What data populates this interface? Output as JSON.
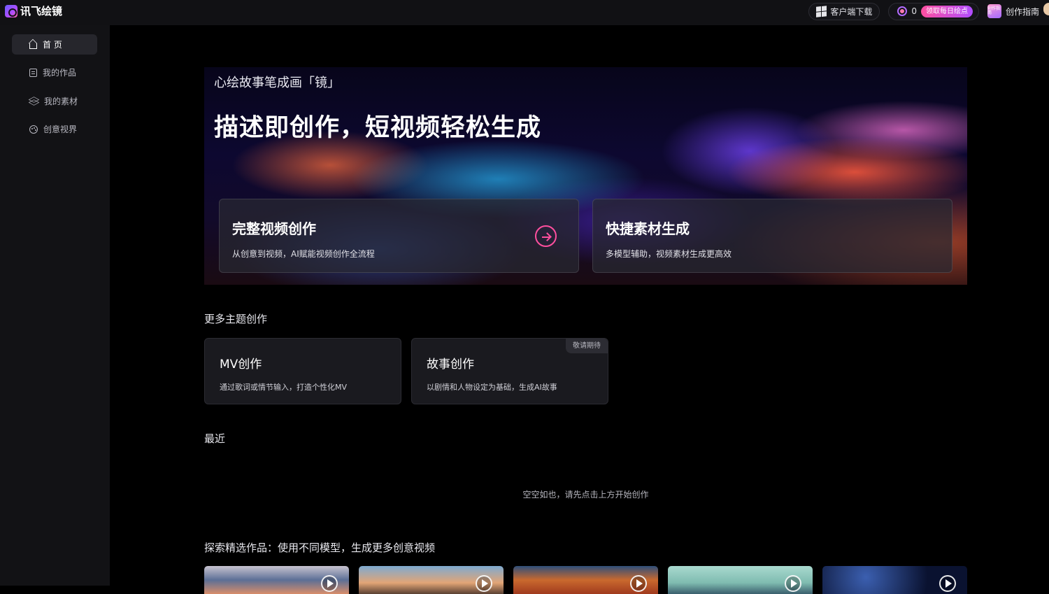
{
  "app": {
    "name": "讯飞绘镜"
  },
  "topbar": {
    "download_label": "客户端下载",
    "credits": "0",
    "daily_points_label": "领取每日绘点",
    "guide_label": "创作指南",
    "guide_icon_text": "创作指南"
  },
  "sidebar": {
    "items": [
      {
        "label": "首 页",
        "icon": "home-icon",
        "active": true
      },
      {
        "label": "我的作品",
        "icon": "document-icon",
        "active": false
      },
      {
        "label": "我的素材",
        "icon": "layers-icon",
        "active": false
      },
      {
        "label": "创意视界",
        "icon": "palette-icon",
        "active": false
      }
    ]
  },
  "hero": {
    "subtitle": "心绘故事笔成画「镜」",
    "title": "描述即创作，短视频轻松生成",
    "cards": [
      {
        "title": "完整视频创作",
        "desc": "从创意到视频，AI赋能视频创作全流程",
        "icon": "arrow-right-circle-icon"
      },
      {
        "title": "快捷素材生成",
        "desc": "多模型辅助，视频素材生成更高效"
      }
    ]
  },
  "themes": {
    "heading": "更多主题创作",
    "cards": [
      {
        "title": "MV创作",
        "desc": "通过歌词或情节输入，打造个性化MV"
      },
      {
        "title": "故事创作",
        "desc": "以剧情和人物设定为基础，生成AI故事",
        "badge": "敬请期待"
      }
    ]
  },
  "recent": {
    "heading": "最近",
    "empty_text": "空空如也，请先点击上方开始创作"
  },
  "explore": {
    "heading": "探索精选作品：使用不同模型，生成更多创意视频",
    "thumb_icon": "play-icon"
  },
  "colors": {
    "accent": "#ff4f9e",
    "accent2": "#b04dff",
    "bg": "#000000",
    "sidebar": "#121215"
  }
}
